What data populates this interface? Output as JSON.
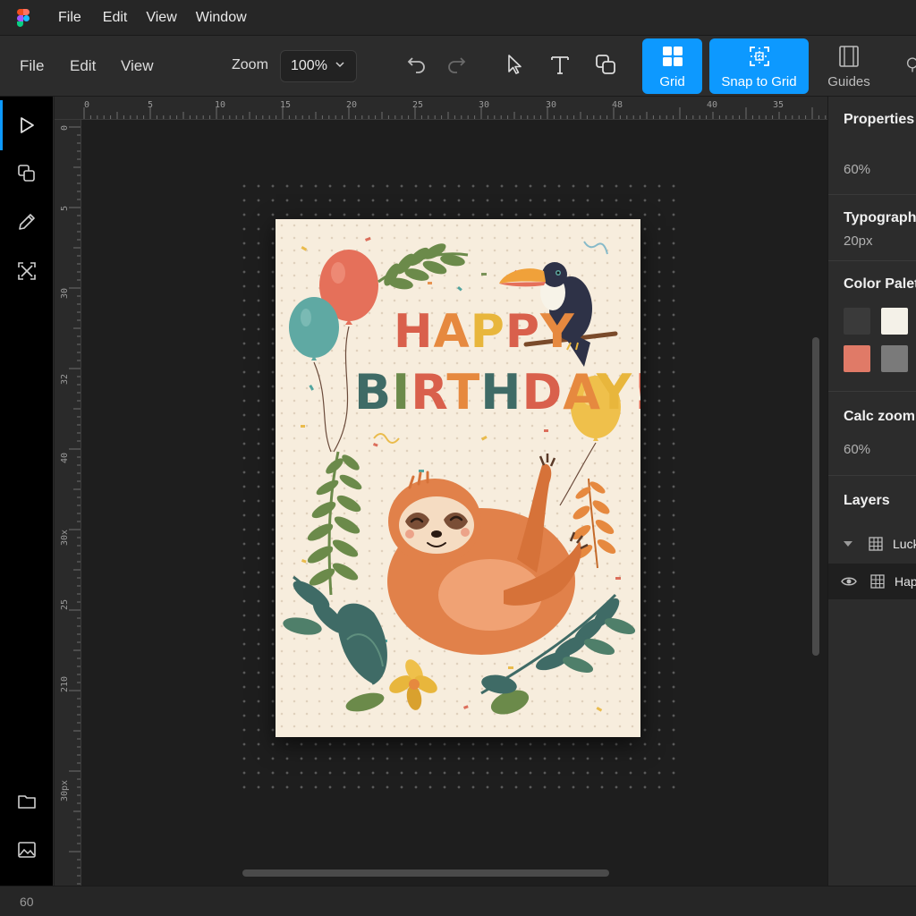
{
  "titlebar": {
    "menus": [
      "File",
      "Edit",
      "View",
      "Window"
    ]
  },
  "toolbar": {
    "menus": [
      "File",
      "Edit",
      "View"
    ],
    "zoom_label": "Zoom",
    "zoom_value": "100%",
    "toggles": [
      {
        "label": "Grid",
        "state": "active"
      },
      {
        "label": "Snap to Grid",
        "state": "active"
      },
      {
        "label": "Guides",
        "state": "inactive"
      }
    ]
  },
  "rulers": {
    "top": [
      "0",
      "5",
      "10",
      "15",
      "20",
      "25",
      "30",
      "30",
      "48",
      "40",
      "35"
    ],
    "left": [
      "0",
      "5",
      "30",
      "32",
      "40",
      "30x",
      "25",
      "210",
      "30px"
    ]
  },
  "artboard": {
    "line1": "HAPPY",
    "line2": "BIRTHDAY!",
    "colors": {
      "background": "#f7eddd",
      "red": "#d9604c",
      "orange": "#e6893f",
      "yellow": "#e8b63c",
      "teal": "#3f6b66",
      "green": "#6b8a4a",
      "sloth": "#e1814a"
    }
  },
  "panel": {
    "properties": {
      "title": "Properties",
      "value": "60%"
    },
    "typography": {
      "title": "Typography",
      "value": "20px"
    },
    "palette": {
      "title": "Color Palette",
      "swatches": [
        "#3a3a3a",
        "#f4f1e8",
        "#e07a67",
        "#7a7a7a"
      ]
    },
    "calc": {
      "title": "Calc zoom",
      "value": "60%"
    },
    "layers": {
      "title": "Layers",
      "items": [
        {
          "name": "Lucky",
          "expanded": true
        },
        {
          "name": "Happy",
          "visible": true
        }
      ]
    }
  },
  "status": {
    "zoom": "60"
  }
}
